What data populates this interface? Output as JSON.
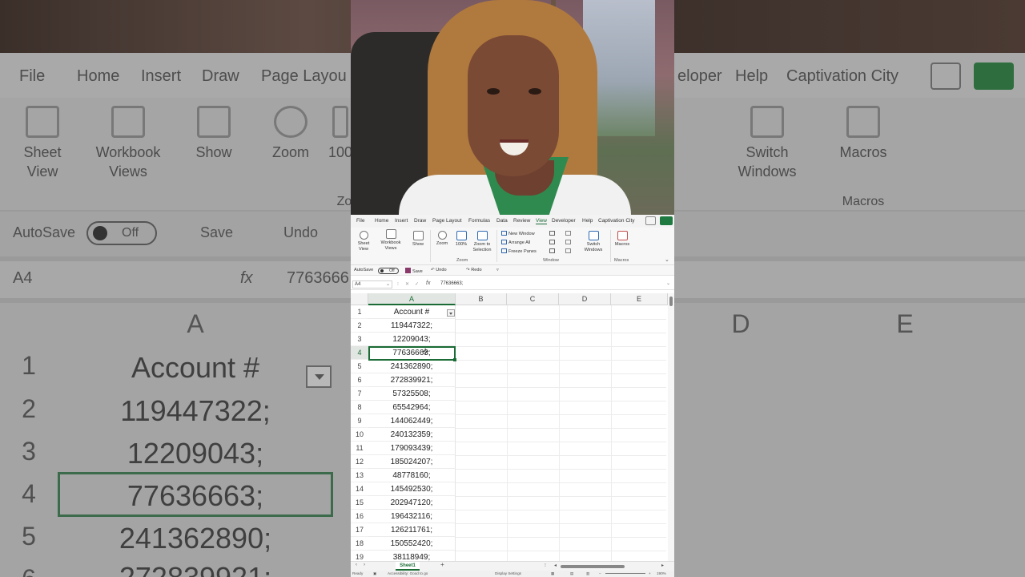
{
  "menu": {
    "items": [
      "File",
      "Home",
      "Insert",
      "Draw",
      "Page Layout",
      "Formulas",
      "Data",
      "Review",
      "View",
      "Developer",
      "Help",
      "Captivation City"
    ],
    "active": "View"
  },
  "background_zoom": {
    "menu_left": [
      "File",
      "Home",
      "Insert",
      "Draw",
      "Page Layou"
    ],
    "menu_right": [
      "eloper",
      "Help",
      "Captivation City"
    ],
    "ribbon": {
      "sheet_view": "Sheet View",
      "workbook_views": "Workbook Views",
      "show": "Show",
      "zoom": "Zoom",
      "zoom_100": "100",
      "switch_windows": "Switch Windows",
      "macros": "Macros",
      "macros_group": "Macros",
      "zoom_group_frag": "Zo"
    },
    "qat": {
      "autosave": "AutoSave",
      "toggle": "Off",
      "save": "Save",
      "undo": "Undo"
    },
    "namebox": "A4",
    "formula_value": "7763666",
    "col_a": "A",
    "col_d": "D",
    "col_e": "E",
    "rows": [
      "1",
      "2",
      "3",
      "4",
      "5",
      "6"
    ],
    "cells": [
      "Account #",
      "119447322;",
      "12209043;",
      "77636663;",
      "241362890;",
      "272839921;"
    ]
  },
  "ribbon": {
    "sheet_view": "Sheet View",
    "workbook_views": "Workbook Views",
    "show": "Show",
    "zoom": "Zoom",
    "zoom_100": "100%",
    "zoom_to_selection": "Zoom to Selection",
    "new_window": "New Window",
    "arrange_all": "Arrange All",
    "freeze_panes": "Freeze Panes",
    "switch_windows": "Switch Windows",
    "macros": "Macros",
    "group_zoom": "Zoom",
    "group_window": "Window",
    "group_macros": "Macros"
  },
  "qat": {
    "autosave": "AutoSave",
    "toggle": "Off",
    "save": "Save",
    "undo": "Undo",
    "redo": "Redo"
  },
  "formula_bar": {
    "namebox": "A4",
    "fx": "fx",
    "value": "77636663;"
  },
  "grid": {
    "columns": [
      "A",
      "B",
      "C",
      "D",
      "E"
    ],
    "rows": [
      "1",
      "2",
      "3",
      "4",
      "5",
      "6",
      "7",
      "8",
      "9",
      "10",
      "11",
      "12",
      "13",
      "14",
      "15",
      "16",
      "17",
      "18",
      "19"
    ],
    "col_a": [
      "Account #",
      "119447322;",
      "12209043;",
      "77636663;",
      "241362890;",
      "272839921;",
      "57325508;",
      "65542964;",
      "144062449;",
      "240132359;",
      "179093439;",
      "185024207;",
      "48778160;",
      "145492530;",
      "202947120;",
      "196432116;",
      "126211761;",
      "150552420;",
      "38118949;"
    ],
    "active_cell": "A4"
  },
  "sheet_tabs": {
    "current": "Sheet1",
    "add": "+"
  },
  "status": {
    "ready": "Ready",
    "accessibility": "Accessibility: Good to go",
    "display": "Display Settings",
    "zoom": "190%"
  },
  "colors": {
    "excel_green": "#1a6b35",
    "share_green": "#1e7a40"
  }
}
